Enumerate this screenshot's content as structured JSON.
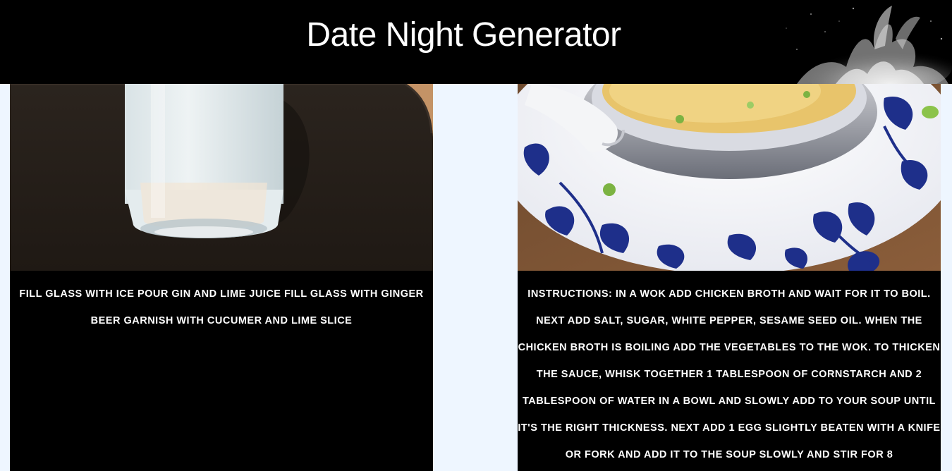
{
  "header": {
    "title": "Date Night Generator"
  },
  "drink": {
    "image_alt": "cocktail-photo",
    "instructions": "Fill glass with ice Pour gin and lime juice Fill glass with ginger beer Garnish with cucumer and lime slice"
  },
  "meal": {
    "image_alt": "soup-photo",
    "instructions": "Instructions: In a wok add chicken broth and wait for it to boil. Next add salt, sugar, white pepper, sesame seed oil. When the chicken broth is boiling add the vegetables to the wok. To thicken the sauce, whisk together 1 tablespoon of cornstarch and 2 tablespoon of water in a bowl and slowly add to your soup until it's the right thickness. Next add 1 egg slightly beaten with a knife or fork and add it to the soup slowly and stir for 8"
  },
  "colors": {
    "page_background": "#eef6ff",
    "header_background": "#000000",
    "card_background": "#000000",
    "text": "#ffffff"
  }
}
